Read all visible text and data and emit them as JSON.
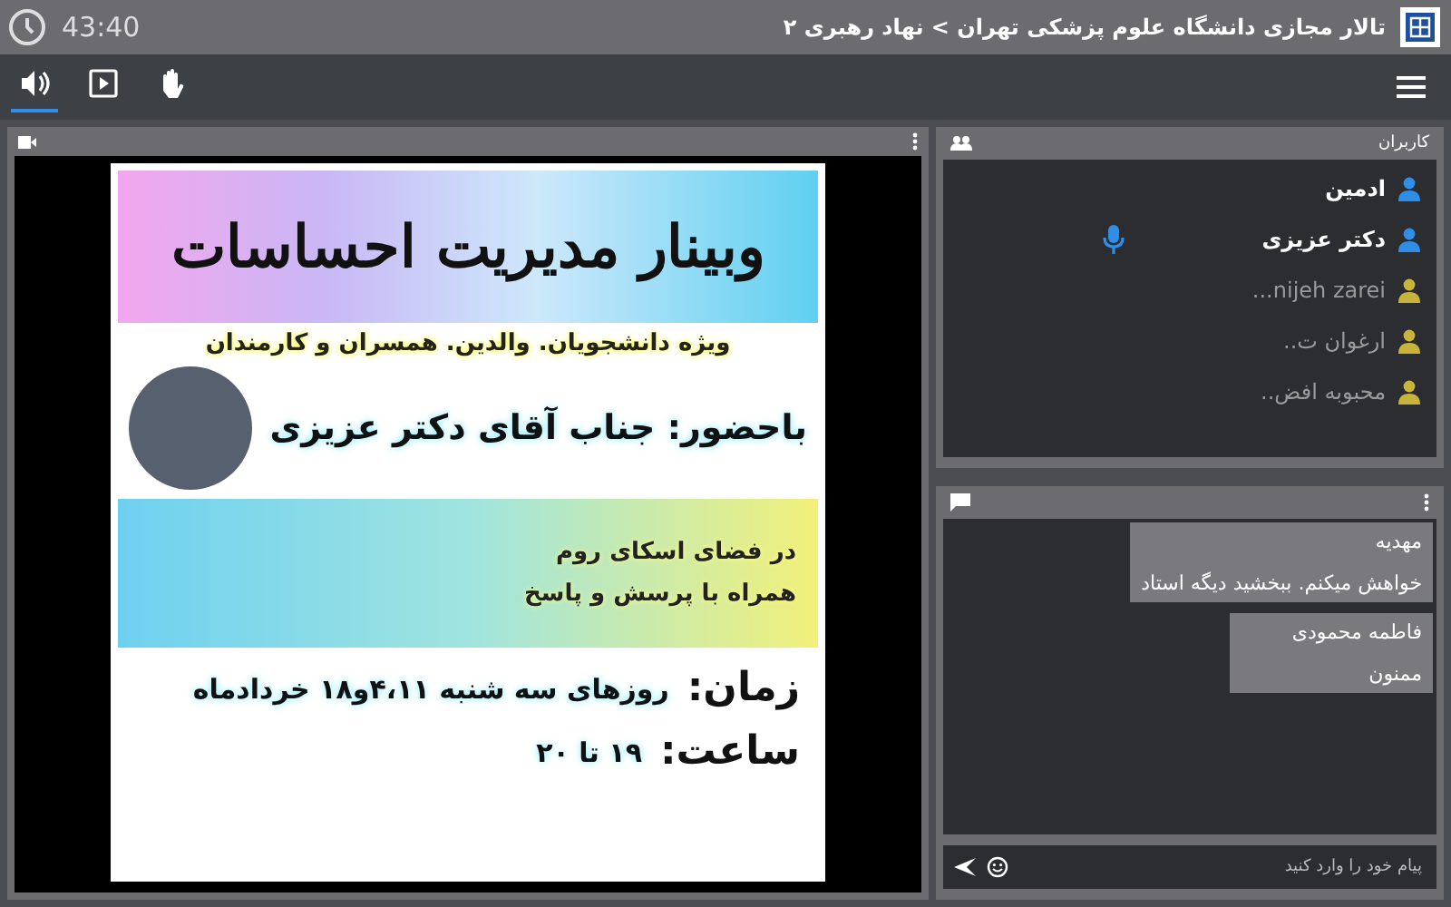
{
  "header": {
    "title": "تالار مجازی دانشگاه علوم پزشکی تهران > نهاد رهبری ۲",
    "timer": "43:40"
  },
  "toolbar": {
    "tabs": [
      {
        "kind": "audio",
        "selected": true
      },
      {
        "kind": "video",
        "selected": false
      },
      {
        "kind": "hand",
        "selected": false
      }
    ]
  },
  "slide": {
    "title": "وبینار مدیریت احساسات",
    "subtitle": "ویژه دانشجویان. والدین. همسران و کارمندان",
    "presenter": "باحضور: جناب آقای دکتر عزیزی",
    "venue": [
      "در فضای اسکای روم",
      "همراه با پرسش و پاسخ"
    ],
    "time_label": "زمان:",
    "time": "روزهای سه شنبه ۴،۱۱و۱۸ خردادماه",
    "hour_label": "ساعت:",
    "hour": "۱۹ تا ۲۰"
  },
  "users": {
    "title": "کاربران",
    "items": [
      {
        "name": "ادمین",
        "kind": "host",
        "mic": false
      },
      {
        "name": "دکتر عزیزی",
        "kind": "host",
        "mic": true
      },
      {
        "name": "nijeh zarei...",
        "kind": "participant",
        "mic": false
      },
      {
        "name": "ارغوان ت..",
        "kind": "participant",
        "mic": false
      },
      {
        "name": "محبوبه افض..",
        "kind": "participant",
        "mic": false
      }
    ]
  },
  "chat": {
    "messages": [
      {
        "name": "مهدیه",
        "text": "خواهش میکنم. ببخشید دیگه استاد"
      },
      {
        "name": "فاطمه محمودی",
        "text": "ممنون"
      }
    ],
    "placeholder": "پیام خود را وارد کنید"
  }
}
